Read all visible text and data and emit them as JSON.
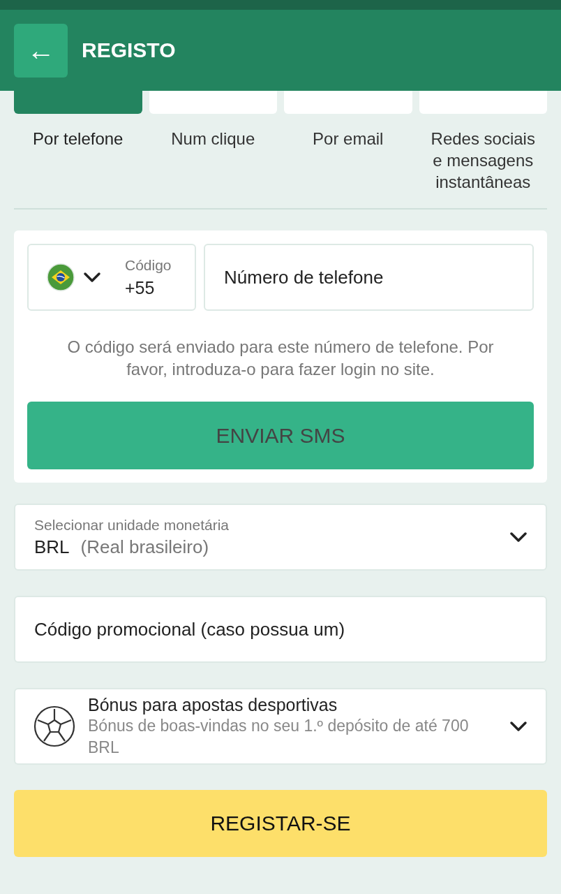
{
  "header": {
    "back": "←",
    "title": "REGISTO"
  },
  "tabs": [
    {
      "label": "Por telefone",
      "selected": true
    },
    {
      "label": "Num clique",
      "selected": false
    },
    {
      "label": "Por email",
      "selected": false
    },
    {
      "label": "Redes sociais e mensagens instantâneas",
      "selected": false
    }
  ],
  "phone_form": {
    "code_label": "Código",
    "code_value": "+55",
    "phone_placeholder": "Número de telefone",
    "hint": "O código será enviado para este número de telefone. Por favor, introduza-o para fazer login no site.",
    "send_button": "ENVIAR SMS"
  },
  "currency": {
    "label": "Selecionar unidade monetária",
    "code": "BRL",
    "name": "(Real brasileiro)"
  },
  "promo": {
    "placeholder": "Código promocional (caso possua um)"
  },
  "bonus": {
    "title": "Bónus para apostas desportivas",
    "description": "Bónus de boas-vindas no seu 1.º depósito de até 700 BRL"
  },
  "register_button": "REGISTAR-SE"
}
